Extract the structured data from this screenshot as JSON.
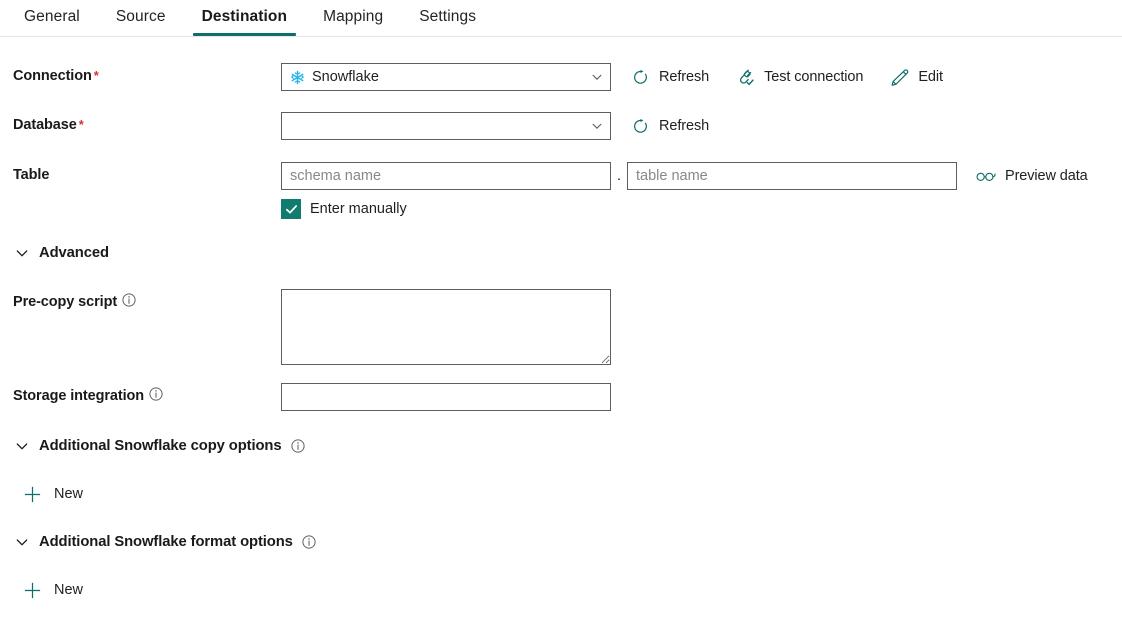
{
  "tabs": [
    {
      "label": "General",
      "active": false
    },
    {
      "label": "Source",
      "active": false
    },
    {
      "label": "Destination",
      "active": true
    },
    {
      "label": "Mapping",
      "active": false
    },
    {
      "label": "Settings",
      "active": false
    }
  ],
  "colors": {
    "accent_teal": "#0f6e6c",
    "icon_teal": "#0f6e6c",
    "checkbox_green": "#107c70",
    "snowflake_blue": "#29b5e8",
    "required_red": "#d13438",
    "border_gray": "#605e5c",
    "placeholder_gray": "#8a8886"
  },
  "form": {
    "connection": {
      "label": "Connection",
      "required": true,
      "value": "Snowflake",
      "icon": "snowflake-icon",
      "chevron": "chevron-down-icon",
      "commands": [
        {
          "label": "Refresh",
          "icon": "refresh-icon"
        },
        {
          "label": "Test connection",
          "icon": "plug-check-icon"
        },
        {
          "label": "Edit",
          "icon": "pencil-icon"
        }
      ]
    },
    "database": {
      "label": "Database",
      "required": true,
      "value": "",
      "chevron": "chevron-down-icon",
      "commands": [
        {
          "label": "Refresh",
          "icon": "refresh-icon"
        }
      ]
    },
    "table": {
      "label": "Table",
      "required": false,
      "schema_placeholder": "schema name",
      "schema_value": "",
      "separator": ".",
      "table_placeholder": "table name",
      "table_value": "",
      "commands": [
        {
          "label": "Preview data",
          "icon": "glasses-icon"
        }
      ]
    },
    "enter_manually": {
      "label": "Enter manually",
      "checked": true
    },
    "advanced": {
      "label": "Advanced",
      "expanded": true
    },
    "pre_copy_script": {
      "label": "Pre-copy script",
      "info": "info-icon",
      "value": ""
    },
    "storage_integration": {
      "label": "Storage integration",
      "info": "info-icon",
      "value": ""
    },
    "copy_options": {
      "label": "Additional Snowflake copy options",
      "info": "info-icon",
      "expanded": true,
      "new_label": "New"
    },
    "format_options": {
      "label": "Additional Snowflake format options",
      "info": "info-icon",
      "expanded": true,
      "new_label": "New"
    }
  }
}
